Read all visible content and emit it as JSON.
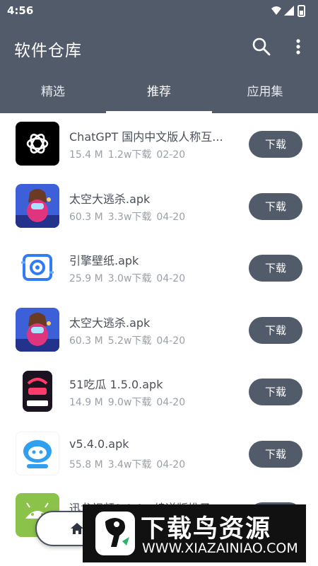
{
  "status_bar": {
    "time": "4:56",
    "icons": [
      "wifi-icon",
      "signal-icon",
      "battery-icon"
    ]
  },
  "app_bar": {
    "title": "软件仓库",
    "actions": [
      "search-icon",
      "more-vert-icon"
    ]
  },
  "tabs": [
    {
      "label": "精选",
      "selected": false
    },
    {
      "label": "推荐",
      "selected": true
    },
    {
      "label": "应用集",
      "selected": false
    }
  ],
  "apps": [
    {
      "name": "ChatGPT 国内中文版人称互...",
      "size": "15.4 M",
      "downloads": "1.2w下载",
      "date": "02-20",
      "button": "下载",
      "icon": "chatgpt-icon"
    },
    {
      "name": "太空大逃杀.apk",
      "size": "60.3 M",
      "downloads": "3.3w下载",
      "date": "04-20",
      "button": "下载",
      "icon": "space-escape-game-icon"
    },
    {
      "name": "引擎壁纸.apk",
      "size": "25.9 M",
      "downloads": "3.0w下载",
      "date": "04-20",
      "button": "下载",
      "icon": "wallpaper-engine-icon"
    },
    {
      "name": "太空大逃杀.apk",
      "size": "60.3 M",
      "downloads": "5.2w下载",
      "date": "04-20",
      "button": "下载",
      "icon": "space-escape-game-icon"
    },
    {
      "name": "51吃瓜 1.5.0.apk",
      "size": "14.9 M",
      "downloads": "9.0w下载",
      "date": "04-20",
      "button": "下载",
      "icon": "51-chigua-icon"
    },
    {
      "name": "v5.4.0.apk",
      "size": "55.8 M",
      "downloads": "3.4w下载",
      "date": "04-20",
      "button": "下载",
      "icon": "cartoon-robot-icon"
    },
    {
      "name": "迅龙视频9.0.0...续逆版推子",
      "size": "",
      "downloads": "",
      "date": "",
      "button": "下载",
      "icon": "android-icon"
    }
  ],
  "bottom_nav": {
    "icon": "home-icon"
  },
  "watermark": {
    "title": "下载鸟资源",
    "url": "WWW.XIAZAINIAO.COM",
    "logo": "xiazainiao-logo"
  },
  "colors": {
    "app_bar": "#525b6a",
    "button": "#525b6a",
    "meta_text": "#9aa0a8",
    "name_text": "#4a4f5a"
  }
}
